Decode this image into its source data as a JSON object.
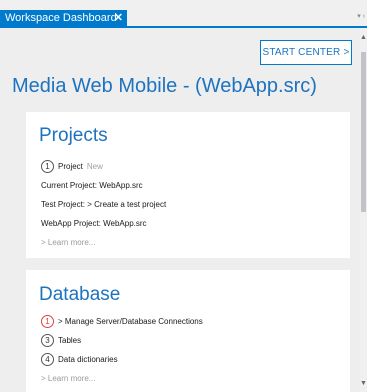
{
  "tab": {
    "title": "Workspace Dashboard",
    "close_glyph": "✕"
  },
  "tab_overflow_glyph": "▾ ›",
  "start_center": {
    "label": "START CENTER >"
  },
  "page_title": "Media Web Mobile - (WebApp.src)",
  "projects": {
    "title": "Projects",
    "step_number": "1",
    "step_label": "Project",
    "new_label": "New",
    "current": "Current Project: WebApp.src",
    "test": "Test Project: > Create a test project",
    "webapp": "WebApp Project: WebApp.src",
    "learn_more": "> Learn more..."
  },
  "database": {
    "title": "Database",
    "items": [
      {
        "number": "1",
        "label": "> Manage Server/Database Connections"
      },
      {
        "number": "3",
        "label": "Tables"
      },
      {
        "number": "4",
        "label": "Data dictionaries"
      }
    ],
    "learn_more": "> Learn more..."
  },
  "colors": {
    "accent": "#007acc",
    "title_blue": "#1e73be",
    "warning_red": "#e04040",
    "panel_bg": "#eeeeef"
  }
}
